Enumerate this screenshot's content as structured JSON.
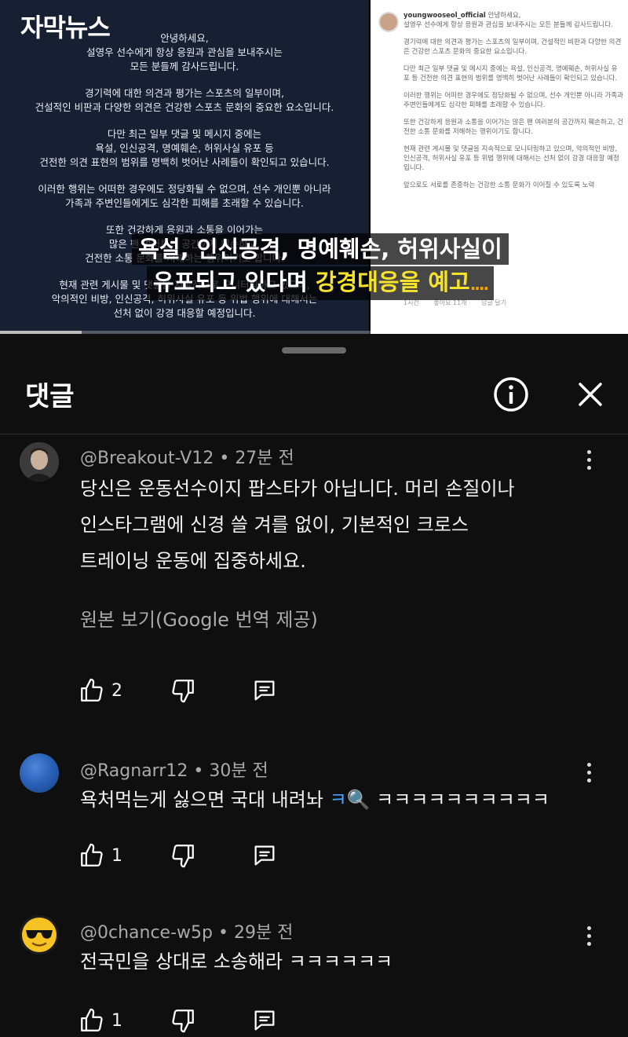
{
  "video": {
    "logo": "자막뉴스",
    "statement": [
      "안녕하세요,\n설영우 선수에게 항상 응원과 관심을 보내주시는\n모든 분들께 감사드립니다.",
      "경기력에 대한 의견과 평가는 스포츠의 일부이며,\n건설적인 비판과 다양한 의견은 건강한 스포츠 문화의 중요한 요소입니다.",
      "다만 최근 일부 댓글 및 메시지 중에는\n욕설, 인신공격, 명예훼손, 허위사실 유포 등\n건전한 의견 표현의 범위를 명백히 벗어난 사례들이 확인되고 있습니다.",
      "이러한 행위는 어떠한 경우에도 정당화될 수 없으며, 선수 개인뿐 아니라\n가족과 주변인들에게도 심각한 피해를 초래할 수 있습니다.",
      "또한 건강하게 응원과 소통을 이어가는\n많은 팬 여러분의 공간까지 훼손하고,\n건전한 소통 문화를 저해하는 행위이기도 합니다.",
      "현재 관련 게시물 및 댓글을 지속적으로 모니터링하고 있으며,\n악의적인 비방, 인신공격, 허위사실 유포 등 위법 행위에 대해서는\n선처 없이 강경 대응할 예정입니다."
    ],
    "instagram": {
      "username": "youngwooseol_official",
      "greeting": "안녕하세요,",
      "paragraphs": [
        "설영우 선수에게 항상 응원과 관심을 보내주시는 모든 분들께 감사드립니다.",
        "경기력에 대한 의견과 평가는 스포츠의 일부이며, 건설적인 비판과 다양한 의견은 건강한 스포츠 문화의 중요한 요소입니다.",
        "다만 최근 일부 댓글 및 메시지 중에는 욕설, 인신공격, 명예훼손, 허위사실 유포 등 건전한 의견 표현의 범위를 명백히 벗어난 사례들이 확인되고 있습니다.",
        "이러한 행위는 어떠한 경우에도 정당화될 수 없으며, 선수 개인뿐 아니라 가족과 주변인들에게도 심각한 피해를 초래할 수 있습니다.",
        "또한 건강하게 응원과 소통을 이어가는 많은 팬 여러분의 공간까지 훼손하고, 건전한 소통 문화를 저해하는 행위이기도 합니다.",
        "현재 관련 게시물 및 댓글을 지속적으로 모니터링하고 있으며, 악의적인 비방, 인신공격, 허위사실 유포 등 위법 행위에 대해서는 선처 없이 강경 대응할 예정입니다.",
        "앞으로도 서로를 존중하는 건강한 소통 문화가 이어질 수 있도록 노력"
      ],
      "time": "1시간",
      "likes": "좋아요 11개",
      "reply": "답글 달기"
    },
    "caption_line1": "욕설, 인신공격, 명예훼손, 허위사실이",
    "caption_line2_a": "유포되고 있다며 ",
    "caption_line2_hl": "강경대응을 예고",
    "caption_dots": "....",
    "progress": 0.13
  },
  "sheet": {
    "title": "댓글"
  },
  "comments": [
    {
      "author": "@Breakout-V12 • 27분 전",
      "text": "당신은 운동선수이지 팝스타가 아닙니다. 머리 손질이나\n인스타그램에 신경 쓸 겨를 없이, 기본적인 크로스\n트레이닝 운동에 집중하세요.",
      "translate": "원본 보기(Google 번역 제공)",
      "likes": "2"
    },
    {
      "author": "@Ragnarr12 • 30분 전",
      "text_a": "욕처먹는게 싫으면 국대 내려놔 ",
      "text_q": "ㅋ🔍",
      "text_b": " ㅋㅋㅋㅋㅋㅋㅋㅋㅋㅋ",
      "likes": "1"
    },
    {
      "author": "@0chance-w5p • 29분 전",
      "text": "전국민을 상대로 소송해라 ㅋㅋㅋㅋㅋㅋ",
      "likes": "1"
    }
  ]
}
